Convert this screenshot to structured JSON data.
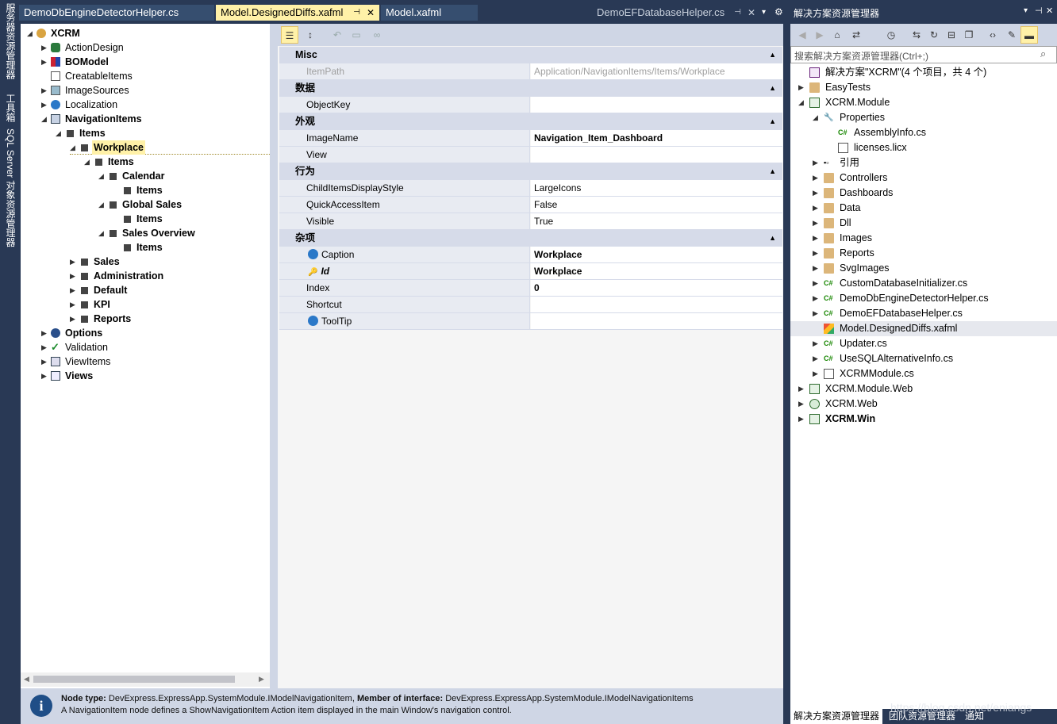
{
  "left_strip": {
    "tabs": [
      "服务器资源管理器",
      "工具箱",
      "SQL Server 对象资源管理器"
    ]
  },
  "tabs": [
    {
      "label": "DemoDbEngineDetectorHelper.cs"
    },
    {
      "label": "Model.DesignedDiffs.xafml",
      "pin": "⊣",
      "close": "✕"
    },
    {
      "label": "Model.xafml"
    },
    {
      "label": "DemoEFDatabaseHelper.cs",
      "pin": "⊣",
      "close": "✕"
    }
  ],
  "tree": {
    "nodes": [
      {
        "label": "XCRM",
        "arrow": "◢",
        "bold": true,
        "icon": "gear-icon"
      },
      {
        "label": "ActionDesign",
        "arrow": "▶",
        "icon": "actions-icon"
      },
      {
        "label": "BOModel",
        "arrow": "▶",
        "bold": true,
        "icon": "bomodel-icon"
      },
      {
        "label": "CreatableItems",
        "icon": "list-icon"
      },
      {
        "label": "ImageSources",
        "arrow": "▶",
        "icon": "image-icon"
      },
      {
        "label": "Localization",
        "arrow": "▶",
        "icon": "globe-icon"
      },
      {
        "label": "NavigationItems",
        "arrow": "◢",
        "bold": true,
        "icon": "navigation-icon"
      },
      {
        "label": "Items",
        "arrow": "◢",
        "bold": true
      },
      {
        "label": "Workplace",
        "arrow": "◢",
        "bold": true,
        "selected": true
      },
      {
        "label": "Items",
        "arrow": "◢",
        "bold": true
      },
      {
        "label": "Calendar",
        "arrow": "◢",
        "bold": true
      },
      {
        "label": "Items",
        "bold": true
      },
      {
        "label": "Global Sales",
        "arrow": "◢",
        "bold": true
      },
      {
        "label": "Items",
        "bold": true
      },
      {
        "label": "Sales Overview",
        "arrow": "◢",
        "bold": true
      },
      {
        "label": "Items",
        "bold": true
      },
      {
        "label": "Sales",
        "arrow": "▶",
        "bold": true
      },
      {
        "label": "Administration",
        "arrow": "▶",
        "bold": true
      },
      {
        "label": "Default",
        "arrow": "▶",
        "bold": true
      },
      {
        "label": "KPI",
        "arrow": "▶",
        "bold": true
      },
      {
        "label": "Reports",
        "arrow": "▶",
        "bold": true
      },
      {
        "label": "Options",
        "arrow": "▶",
        "bold": true,
        "icon": "options-gear-icon"
      },
      {
        "label": "Validation",
        "arrow": "▶",
        "icon": "checkmark-icon"
      },
      {
        "label": "ViewItems",
        "arrow": "▶",
        "icon": "viewitems-icon"
      },
      {
        "label": "Views",
        "arrow": "▶",
        "bold": true,
        "icon": "views-icon"
      }
    ]
  },
  "property_grid": {
    "toolbar": [
      "categorized",
      "alphabetical",
      "undo",
      "reset",
      "link"
    ],
    "categories": [
      {
        "name": "Misc",
        "rows": [
          {
            "name": "ItemPath",
            "value": "Application/NavigationItems/Items/Workplace",
            "readonly": true
          }
        ]
      },
      {
        "name": "数据",
        "rows": [
          {
            "name": "ObjectKey",
            "value": ""
          }
        ]
      },
      {
        "name": "外观",
        "rows": [
          {
            "name": "ImageName",
            "value": "Navigation_Item_Dashboard",
            "bold": true
          },
          {
            "name": "View",
            "value": ""
          }
        ]
      },
      {
        "name": "行为",
        "rows": [
          {
            "name": "ChildItemsDisplayStyle",
            "value": "LargeIcons"
          },
          {
            "name": "QuickAccessItem",
            "value": "False"
          },
          {
            "name": "Visible",
            "value": "True"
          }
        ]
      },
      {
        "name": "杂项",
        "rows": [
          {
            "name": "Caption",
            "value": "Workplace",
            "bold": true,
            "icon": "globe-icon"
          },
          {
            "name": "Id",
            "value": "Workplace",
            "bold": true,
            "icon": "key-icon",
            "italic": true
          },
          {
            "name": "Index",
            "value": "0",
            "bold": true
          },
          {
            "name": "Shortcut",
            "value": ""
          },
          {
            "name": "ToolTip",
            "value": "",
            "icon": "globe-icon"
          }
        ]
      }
    ]
  },
  "info": {
    "node_type_label": "Node type:",
    "node_type": "DevExpress.ExpressApp.SystemModule.IModelNavigationItem,",
    "member_label": "Member of interface:",
    "member": "DevExpress.ExpressApp.SystemModule.IModelNavigationItems",
    "description": "A NavigationItem node defines a ShowNavigationItem Action item displayed in the main Window's navigation control."
  },
  "solution_explorer": {
    "title": "解决方案资源管理器",
    "search_placeholder": "搜索解决方案资源管理器(Ctrl+;)",
    "nodes": [
      {
        "label": "解决方案\"XCRM\"(4 个项目，共 4 个)",
        "icon": "solution-icon"
      },
      {
        "label": "EasyTests",
        "arrow": "▶",
        "icon": "folder-icon"
      },
      {
        "label": "XCRM.Module",
        "arrow": "◢",
        "icon": "csproj-icon"
      },
      {
        "label": "Properties",
        "arrow": "◢",
        "icon": "wrench-icon"
      },
      {
        "label": "AssemblyInfo.cs",
        "icon": "cs-file-icon"
      },
      {
        "label": "licenses.licx",
        "icon": "file-icon"
      },
      {
        "label": "引用",
        "arrow": "▶",
        "icon": "references-icon"
      },
      {
        "label": "Controllers",
        "arrow": "▶",
        "icon": "folder-icon"
      },
      {
        "label": "Dashboards",
        "arrow": "▶",
        "icon": "folder-icon"
      },
      {
        "label": "Data",
        "arrow": "▶",
        "icon": "folder-icon"
      },
      {
        "label": "Dll",
        "arrow": "▶",
        "icon": "folder-icon"
      },
      {
        "label": "Images",
        "arrow": "▶",
        "icon": "folder-icon"
      },
      {
        "label": "Reports",
        "arrow": "▶",
        "icon": "folder-icon"
      },
      {
        "label": "SvgImages",
        "arrow": "▶",
        "icon": "folder-icon"
      },
      {
        "label": "CustomDatabaseInitializer.cs",
        "arrow": "▶",
        "icon": "cs-file-icon"
      },
      {
        "label": "DemoDbEngineDetectorHelper.cs",
        "arrow": "▶",
        "icon": "cs-file-icon"
      },
      {
        "label": "DemoEFDatabaseHelper.cs",
        "arrow": "▶",
        "icon": "cs-file-icon"
      },
      {
        "label": "Model.DesignedDiffs.xafml",
        "icon": "xafml-icon",
        "selected": true
      },
      {
        "label": "Updater.cs",
        "arrow": "▶",
        "icon": "cs-file-icon"
      },
      {
        "label": "UseSQLAlternativeInfo.cs",
        "arrow": "▶",
        "icon": "cs-file-icon"
      },
      {
        "label": "XCRMModule.cs",
        "arrow": "▶",
        "icon": "module-file-icon"
      },
      {
        "label": "XCRM.Module.Web",
        "arrow": "▶",
        "icon": "csproj-icon"
      },
      {
        "label": "XCRM.Web",
        "arrow": "▶",
        "icon": "web-project-icon"
      },
      {
        "label": "XCRM.Win",
        "arrow": "▶",
        "icon": "csproj-icon",
        "bold": true
      }
    ],
    "bottom_tabs": [
      "解决方案资源管理器",
      "团队资源管理器",
      "通知"
    ]
  },
  "watermark": "https://blog.csdn.net/eniangs"
}
